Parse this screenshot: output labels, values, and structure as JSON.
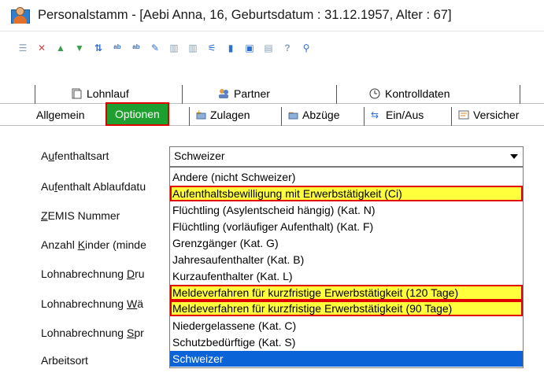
{
  "window": {
    "title": "Personalstamm - [Aebi Anna, 16, Geburtsdatum : 31.12.1957, Alter : 67]"
  },
  "tabs_top": [
    {
      "label": "Lohnlauf",
      "icon": "document-icon"
    },
    {
      "label": "Partner",
      "icon": "people-icon"
    },
    {
      "label": "Kontrolldaten",
      "icon": "clock-icon"
    }
  ],
  "tabs_bottom": [
    {
      "label": "Allgemein"
    },
    {
      "label": "Optionen",
      "active": true
    },
    {
      "label": "Zulagen",
      "icon": "plus-money-icon"
    },
    {
      "label": "Abzüge",
      "icon": "minus-money-icon"
    },
    {
      "label": "Ein/Aus",
      "icon": "arrows-icon"
    },
    {
      "label": "Versicher",
      "icon": "insurance-icon"
    }
  ],
  "form": {
    "labels": [
      {
        "pre": "A",
        "ul": "u",
        "post": "fenthaltsart"
      },
      {
        "pre": "Au",
        "ul": "f",
        "post": "enthalt Ablaufdatu"
      },
      {
        "pre": "",
        "ul": "Z",
        "post": "EMIS Nummer"
      },
      {
        "pre": "Anzahl ",
        "ul": "K",
        "post": "inder (minde"
      },
      {
        "pre": "Lohnabrechnung ",
        "ul": "D",
        "post": "ru"
      },
      {
        "pre": "Lohnabrechnung ",
        "ul": "W",
        "post": "ä"
      },
      {
        "pre": "Lohnabrechnung ",
        "ul": "S",
        "post": "pr"
      },
      {
        "pre": "Arbeitsort",
        "ul": "",
        "post": ""
      }
    ],
    "aufenthaltsart_value": "Schweizer"
  },
  "dropdown_options": [
    {
      "label": "Andere (nicht Schweizer)",
      "highlighted": false,
      "selected": false
    },
    {
      "label": "Aufenthaltsbewilligung mit Erwerbstätigkeit (Ci)",
      "highlighted": true,
      "selected": false
    },
    {
      "label": "Flüchtling (Asylentscheid hängig) (Kat. N)",
      "highlighted": false,
      "selected": false
    },
    {
      "label": "Flüchtling (vorläufiger Aufenthalt) (Kat. F)",
      "highlighted": false,
      "selected": false
    },
    {
      "label": "Grenzgänger (Kat. G)",
      "highlighted": false,
      "selected": false
    },
    {
      "label": "Jahresaufenthalter (Kat. B)",
      "highlighted": false,
      "selected": false
    },
    {
      "label": "Kurzaufenthalter (Kat. L)",
      "highlighted": false,
      "selected": false
    },
    {
      "label": "Meldeverfahren für kurzfristige Erwerbstätigkeit (120 Tage)",
      "highlighted": true,
      "selected": false
    },
    {
      "label": "Meldeverfahren für kurzfristige Erwerbstätigkeit (90 Tage)",
      "highlighted": true,
      "selected": false
    },
    {
      "label": "Niedergelassene (Kat. C)",
      "highlighted": false,
      "selected": false
    },
    {
      "label": "Schutzbedürftige (Kat. S)",
      "highlighted": false,
      "selected": false
    },
    {
      "label": "Schweizer",
      "highlighted": false,
      "selected": true
    }
  ],
  "colors": {
    "active_tab_bg": "#1f9f2f",
    "highlight_bg": "#ffff3c",
    "highlight_border": "#e00000",
    "selection_bg": "#0a64d8"
  }
}
